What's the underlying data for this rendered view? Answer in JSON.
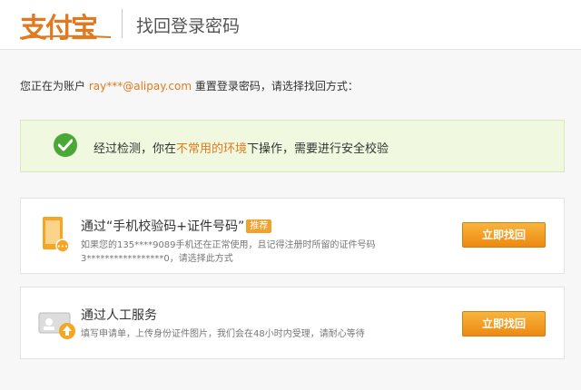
{
  "header": {
    "logo_text": "支付宝",
    "title": "找回登录密码"
  },
  "account": {
    "prefix": "您正在为账户 ",
    "email": "ray***@alipay.com",
    "suffix": " 重置登录密码，请选择找回方式："
  },
  "notice": {
    "text_before": "经过检测，你在",
    "text_warn": "不常用的环境",
    "text_after": "下操作，需要进行安全校验"
  },
  "options": [
    {
      "title": "通过“手机校验码+证件号码”",
      "badge": "推荐",
      "desc_line1": "如果您的135****9089手机还在正常使用，且记得注册时所留的证件号码",
      "desc_line2": "3*****************0，请选择此方式",
      "button": "立即找回",
      "icon": "phone-icon"
    },
    {
      "title": "通过人工服务",
      "desc_line1": "填写申请单，上传身份证件图片，我们会在48小时内受理，请耐心等待",
      "button": "立即找回",
      "icon": "id-upload-icon"
    }
  ],
  "colors": {
    "brand": "#e17a1e",
    "success": "#4aa936",
    "button": "#f0a22e",
    "notice_bg": "#f0f9df"
  }
}
